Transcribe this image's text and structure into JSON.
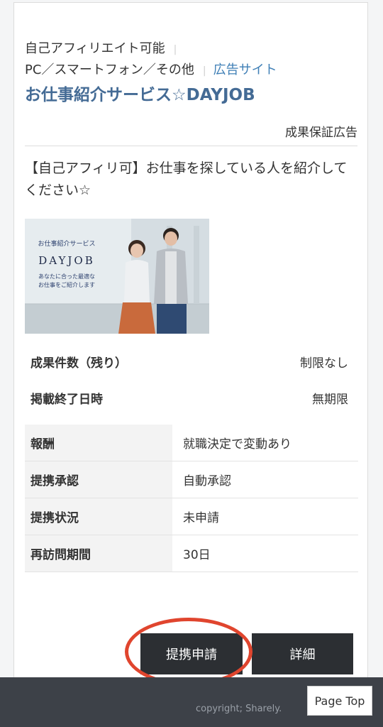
{
  "listing": {
    "tags": [
      "自己アフィリエイト可能",
      "PC／スマートフォン／その他"
    ],
    "site_link": "広告サイト",
    "title": "お仕事紹介サービス☆DAYJOB",
    "guarantee_badge": "成果保証広告",
    "description": "【自己アフィリ可】お仕事を探している人を紹介してください☆",
    "banner": {
      "subtitle": "お仕事紹介サービス",
      "brand": "DAYJOB",
      "tagline_line1": "あなたに合った最適な",
      "tagline_line2": "お仕事をご紹介します"
    }
  },
  "stats": [
    {
      "label": "成果件数（残り）",
      "value": "制限なし"
    },
    {
      "label": "掲載終了日時",
      "value": "無期限"
    }
  ],
  "info_table": [
    {
      "label": "報酬",
      "value": "就職決定で変動あり"
    },
    {
      "label": "提携承認",
      "value": "自動承認"
    },
    {
      "label": "提携状況",
      "value": "未申請"
    },
    {
      "label": "再訪問期間",
      "value": "30日"
    }
  ],
  "actions": {
    "apply": "提携申請",
    "details": "詳細"
  },
  "footer": {
    "copyright": "copyright; Sharely.",
    "page_top": "Page Top"
  },
  "colors": {
    "title": "#446b95",
    "link": "#3f7fb6",
    "button": "#2c2f33",
    "annotation": "#e0452e",
    "footer": "#3d4148"
  }
}
